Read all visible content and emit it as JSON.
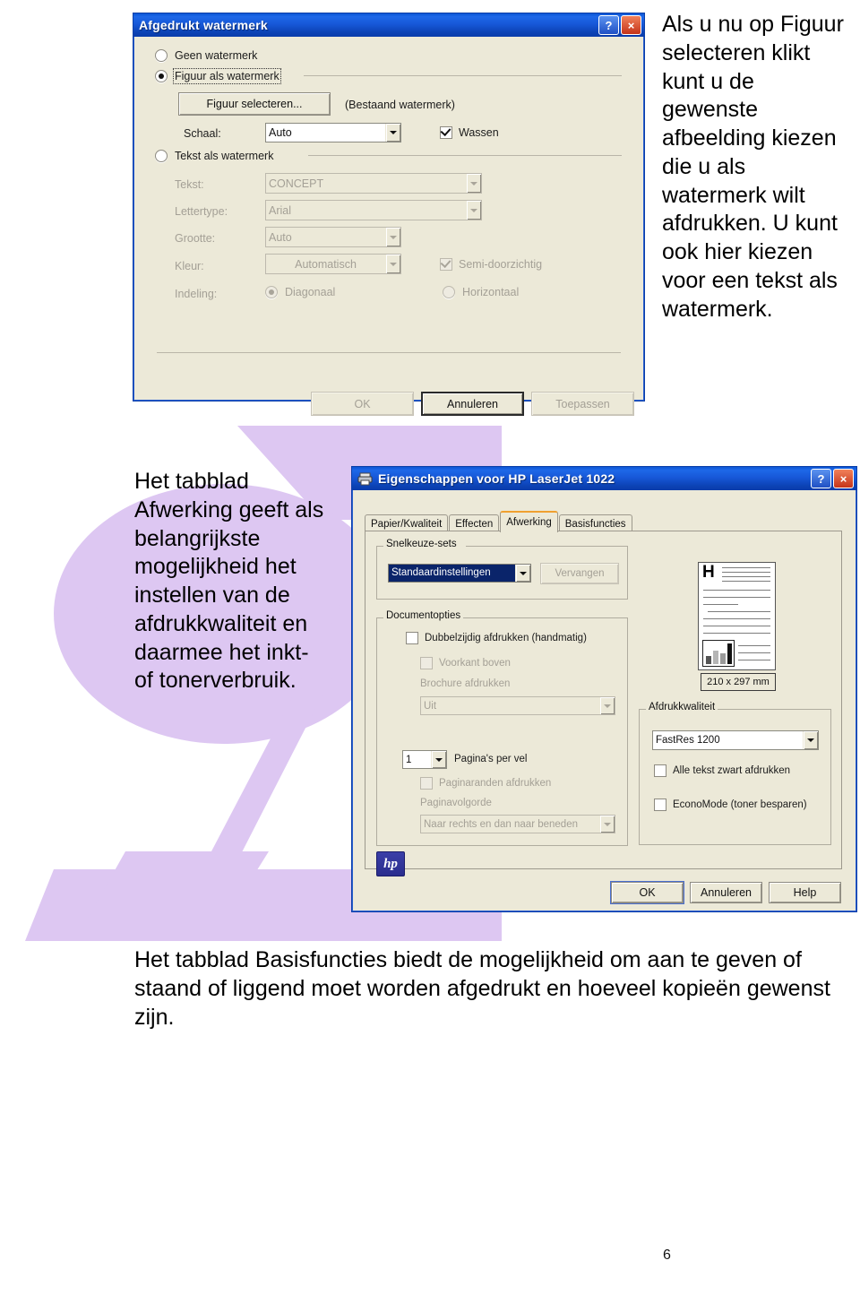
{
  "page": {
    "number": "6"
  },
  "colors": {
    "title_bar_blue": "#0b55d4",
    "dialog_face": "#ECE9D8",
    "purple_swoosh": "#ddc7f2",
    "tab_highlight_orange": "#f0a030",
    "selection_blue": "#0a246a"
  },
  "watermark_dialog": {
    "title": "Afgedrukt watermerk",
    "help_button": "?",
    "close_button": "×",
    "options": {
      "none_label": "Geen watermerk",
      "picture_label": "Figuur als watermerk",
      "text_label": "Tekst als watermerk"
    },
    "select_picture_button": "Figuur selecteren...",
    "existing_watermark_note": "(Bestaand watermerk)",
    "scale_label": "Schaal:",
    "scale_value": "Auto",
    "washout_label": "Wassen",
    "text_label": "Tekst:",
    "text_value": "CONCEPT",
    "font_label": "Lettertype:",
    "font_value": "Arial",
    "size_label": "Grootte:",
    "size_value": "Auto",
    "color_label": "Kleur:",
    "color_value": "Automatisch",
    "semitransparent_label": "Semi-doorzichtig",
    "layout_label": "Indeling:",
    "layout_diagonal": "Diagonaal",
    "layout_horizontal": "Horizontaal",
    "buttons": {
      "ok": "OK",
      "cancel": "Annuleren",
      "apply": "Toepassen"
    }
  },
  "printer_dialog": {
    "title": "Eigenschappen voor HP LaserJet 1022",
    "help_button": "?",
    "close_button": "×",
    "tabs": [
      {
        "label": "Papier/Kwaliteit",
        "active": false
      },
      {
        "label": "Effecten",
        "active": false
      },
      {
        "label": "Afwerking",
        "active": true
      },
      {
        "label": "Basisfuncties",
        "active": false
      }
    ],
    "quicksets": {
      "caption": "Snelkeuze-sets",
      "value": "Standaardinstellingen",
      "replace_button": "Vervangen"
    },
    "document_options": {
      "caption": "Documentopties",
      "duplex_label": "Dubbelzijdig afdrukken (handmatig)",
      "flip_up_label": "Voorkant boven",
      "booklet_label": "Brochure afdrukken",
      "booklet_value": "Uit",
      "pages_per_sheet_value": "1",
      "pages_per_sheet_label": "Pagina's per vel",
      "page_borders_label": "Paginaranden afdrukken",
      "page_order_label": "Paginavolgorde",
      "page_order_value": "Naar rechts en dan naar beneden"
    },
    "preview": {
      "letter": "H",
      "paper_size": "210 x 297 mm"
    },
    "print_quality": {
      "caption": "Afdrukkwaliteit",
      "resolution_value": "FastRes 1200",
      "all_text_black_label": "Alle tekst zwart afdrukken",
      "economode_label": "EconoMode (toner besparen)"
    },
    "brand_logo": "hp",
    "buttons": {
      "ok": "OK",
      "cancel": "Annuleren",
      "help": "Help"
    }
  },
  "texts": {
    "intro": "Als u nu op Figuur selecteren klikt kunt u de gewenste afbeelding kiezen die u als watermerk wilt afdrukken. U kunt ook hier kiezen voor een tekst als watermerk.",
    "finishing": "Het tabblad Afwerking geeft als belangrijkste mogelijkheid het instellen van de afdrukkwaliteit en daarmee het inkt- of tonerverbruik.",
    "basics": "Het tabblad Basisfuncties biedt de mogelijkheid om aan te geven of staand of liggend moet worden afgedrukt  en hoeveel kopieën gewenst zijn."
  }
}
